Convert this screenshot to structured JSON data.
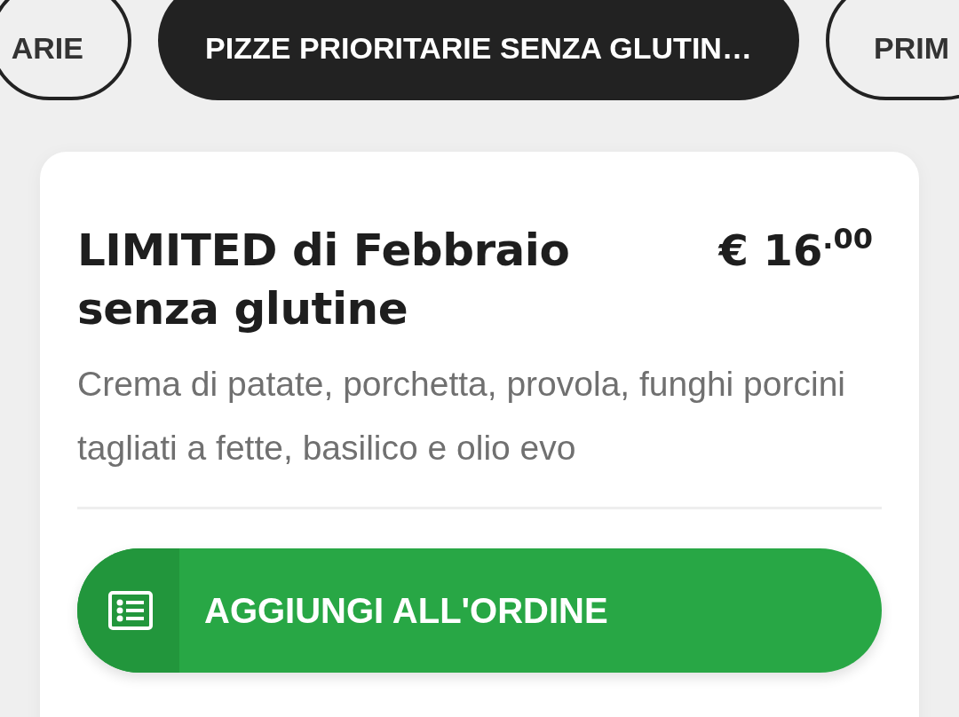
{
  "category_tabs": [
    {
      "label": "ARIE",
      "selected": false
    },
    {
      "label": "PIZZE PRIORITARIE SENZA GLUTIN…",
      "selected": true
    },
    {
      "label": "PRIM",
      "selected": false
    }
  ],
  "product": {
    "name": "LIMITED di Febbraio senza glutine",
    "price": "€ 16",
    "price_cents": ".00",
    "description": "Crema di patate, porchetta, provola, funghi porcini tagliati a fette, basilico e olio evo",
    "add_button": "AGGIUNGI ALL'ORDINE"
  }
}
